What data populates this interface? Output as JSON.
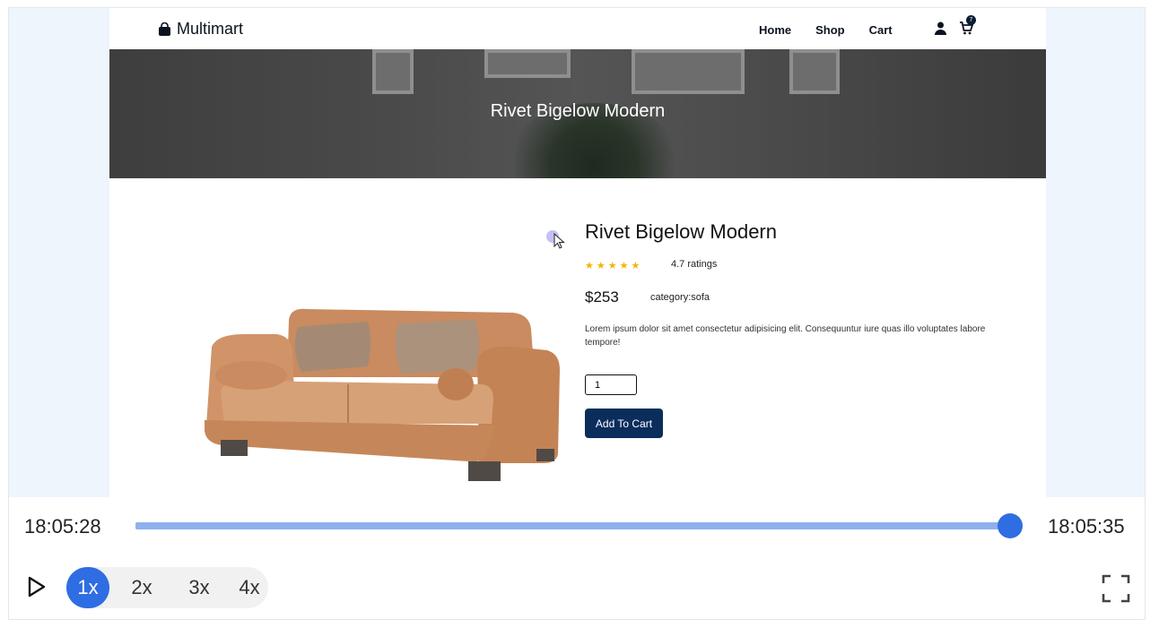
{
  "site": {
    "brand": "Multimart",
    "nav": [
      "Home",
      "Shop",
      "Cart"
    ],
    "cart_count": "7"
  },
  "hero": {
    "title": "Rivet Bigelow Modern"
  },
  "product": {
    "title": "Rivet Bigelow Modern",
    "stars": 5,
    "ratings": "4.7 ratings",
    "price": "$253",
    "category": "category:sofa",
    "description": "Lorem ipsum dolor sit amet consectetur adipisicing elit. Consequuntur iure quas illo voluptates labore tempore!",
    "quantity": "1",
    "add_to_cart": "Add To Cart"
  },
  "player": {
    "start_time": "18:05:28",
    "end_time": "18:05:35",
    "progress": 1.0,
    "speeds": [
      "1x",
      "2x",
      "3x",
      "4x"
    ],
    "active_speed": "1x"
  },
  "colors": {
    "accent": "#2f6de3",
    "button": "#0a2d5c",
    "star": "#f4b400"
  }
}
